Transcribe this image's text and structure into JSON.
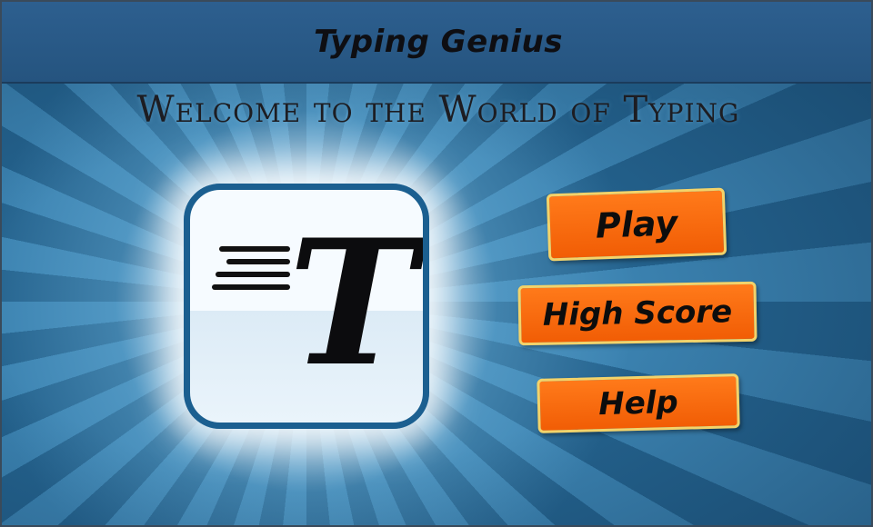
{
  "window": {
    "title": "Typing Genius"
  },
  "welcome_text": "Welcome to the World of Typing",
  "logo": {
    "letter": "T"
  },
  "menu": {
    "play_label": "Play",
    "high_score_label": "High Score",
    "help_label": "Help"
  },
  "colors": {
    "title_bar": "#2d5f8f",
    "background": "#2f6e98",
    "button_fill": "#f26a0c",
    "button_border": "#f3d36a",
    "logo_border": "#1b5f90"
  }
}
